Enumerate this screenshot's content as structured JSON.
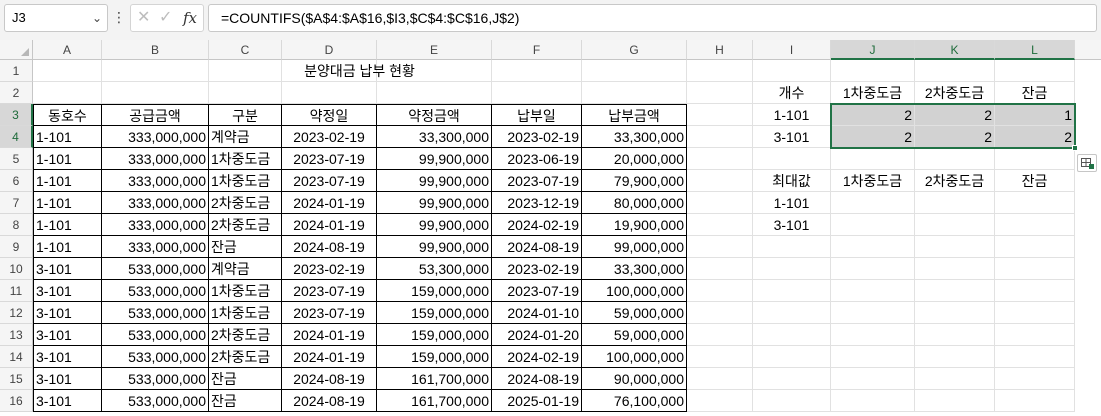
{
  "formula_bar": {
    "name_box": "J3",
    "name_box_icon": "chevron-down-icon",
    "more_icon": "vertical-dots-icon",
    "cancel_icon": "x-icon",
    "enter_icon": "check-icon",
    "fx_label": "fx",
    "formula": "=COUNTIFS($A$4:$A$16,$I3,$C$4:$C$16,J$2)"
  },
  "columns": [
    "A",
    "B",
    "C",
    "D",
    "E",
    "F",
    "G",
    "H",
    "I",
    "J",
    "K",
    "L"
  ],
  "rows": [
    "1",
    "2",
    "3",
    "4",
    "5",
    "6",
    "7",
    "8",
    "9",
    "10",
    "11",
    "12",
    "13",
    "14",
    "15",
    "16"
  ],
  "title": "분양대금 납부 현황",
  "main_table": {
    "headers": [
      "동호수",
      "공급금액",
      "구분",
      "약정일",
      "약정금액",
      "납부일",
      "납부금액"
    ],
    "rows": [
      [
        "1-101",
        "333,000,000",
        "계약금",
        "2023-02-19",
        "33,300,000",
        "2023-02-19",
        "33,300,000"
      ],
      [
        "1-101",
        "333,000,000",
        "1차중도금",
        "2023-07-19",
        "99,900,000",
        "2023-06-19",
        "20,000,000"
      ],
      [
        "1-101",
        "333,000,000",
        "1차중도금",
        "2023-07-19",
        "99,900,000",
        "2023-07-19",
        "79,900,000"
      ],
      [
        "1-101",
        "333,000,000",
        "2차중도금",
        "2024-01-19",
        "99,900,000",
        "2023-12-19",
        "80,000,000"
      ],
      [
        "1-101",
        "333,000,000",
        "2차중도금",
        "2024-01-19",
        "99,900,000",
        "2024-02-19",
        "19,900,000"
      ],
      [
        "1-101",
        "333,000,000",
        "잔금",
        "2024-08-19",
        "99,900,000",
        "2024-08-19",
        "99,000,000"
      ],
      [
        "3-101",
        "533,000,000",
        "계약금",
        "2023-02-19",
        "53,300,000",
        "2023-02-19",
        "33,300,000"
      ],
      [
        "3-101",
        "533,000,000",
        "1차중도금",
        "2023-07-19",
        "159,000,000",
        "2023-07-19",
        "100,000,000"
      ],
      [
        "3-101",
        "533,000,000",
        "1차중도금",
        "2023-07-19",
        "159,000,000",
        "2024-01-10",
        "59,000,000"
      ],
      [
        "3-101",
        "533,000,000",
        "2차중도금",
        "2024-01-19",
        "159,000,000",
        "2024-01-20",
        "59,000,000"
      ],
      [
        "3-101",
        "533,000,000",
        "2차중도금",
        "2024-01-19",
        "159,000,000",
        "2024-02-19",
        "100,000,000"
      ],
      [
        "3-101",
        "533,000,000",
        "잔금",
        "2024-08-19",
        "161,700,000",
        "2024-08-19",
        "90,000,000"
      ],
      [
        "3-101",
        "533,000,000",
        "잔금",
        "2024-08-19",
        "161,700,000",
        "2025-01-19",
        "76,100,000"
      ]
    ]
  },
  "count_table": {
    "header": [
      "개수",
      "1차중도금",
      "2차중도금",
      "잔금"
    ],
    "rows": [
      [
        "1-101",
        "2",
        "2",
        "1"
      ],
      [
        "3-101",
        "2",
        "2",
        "2"
      ]
    ]
  },
  "max_table": {
    "header": [
      "최대값",
      "1차중도금",
      "2차중도금",
      "잔금"
    ],
    "rows": [
      [
        "1-101",
        "",
        "",
        ""
      ],
      [
        "3-101",
        "",
        "",
        ""
      ]
    ]
  },
  "quick_analysis_icon": "quick-analysis-icon",
  "colors": {
    "selection": "#217346",
    "highlight": "#d2d2d2"
  }
}
